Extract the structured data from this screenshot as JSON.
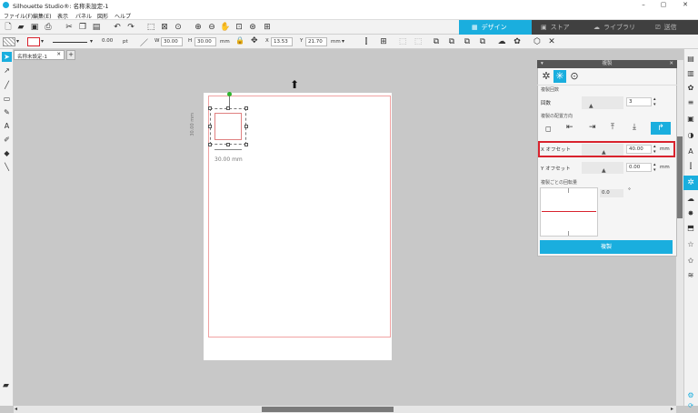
{
  "app": {
    "title": "Silhouette Studio®: 名称未設定-1",
    "icon": "silhouette-logo-icon"
  },
  "menu": {
    "items": [
      "ファイル(F)",
      "編集(E)",
      "表示",
      "パネル",
      "図形",
      "ヘルプ"
    ]
  },
  "nav": {
    "tabs": [
      {
        "label": "デザイン",
        "icon": "design-grid-icon",
        "active": true
      },
      {
        "label": "ストア",
        "icon": "store-s-icon",
        "active": false
      },
      {
        "label": "ライブラリ",
        "icon": "library-cloud-icon",
        "active": false
      },
      {
        "label": "送信",
        "icon": "send-machine-icon",
        "active": false
      }
    ]
  },
  "toolbar2": {
    "line_width": "0.00",
    "line_unit": "pt",
    "w_label": "W",
    "w_value": "30.00",
    "h_label": "H",
    "h_value": "30.00",
    "size_unit": "mm",
    "x_label": "X",
    "x_value": "13.53",
    "y_label": "Y",
    "y_value": "21.70",
    "pos_unit": "mm"
  },
  "document": {
    "tab_label": "名称未設定-1",
    "add_tab": "+"
  },
  "canvas": {
    "width_label": "30.00 mm",
    "height_label": "30.00 mm"
  },
  "panel": {
    "title": "複製",
    "section_rotate": "複製回数",
    "count_label": "回数",
    "count_value": "3",
    "section_direction": "複製の配置方向",
    "x_offset_label": "X オフセット",
    "x_offset_value": "40.00",
    "x_offset_unit": "mm",
    "y_offset_label": "Y オフセット",
    "y_offset_value": "0.00",
    "y_offset_unit": "mm",
    "section_rotation_amount": "複製ごとの回転量",
    "rotation_value": "0.0",
    "rotation_unit": "°",
    "apply_label": "複製"
  },
  "colors": {
    "accent": "#1aaede",
    "highlight_border": "#d9232e",
    "cut_line": "#f1a3a3"
  }
}
